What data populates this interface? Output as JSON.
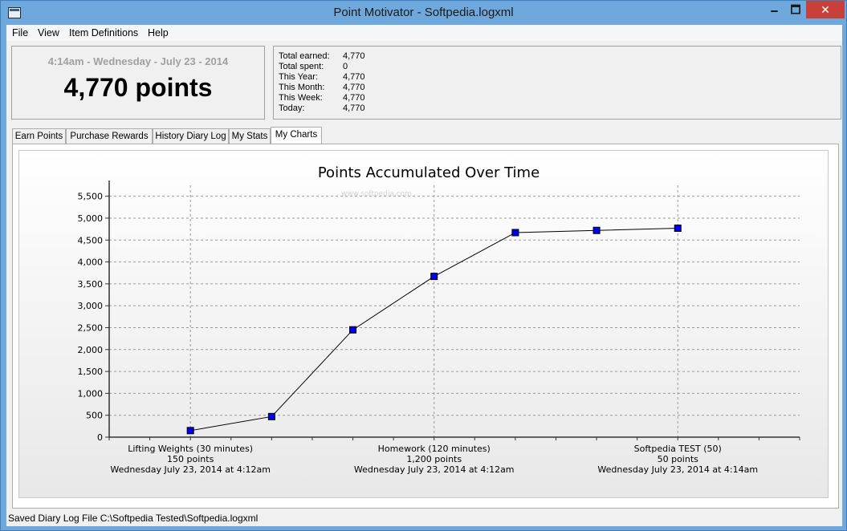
{
  "window": {
    "title": "Point Motivator - Softpedia.logxml",
    "min_label": "🗕",
    "max_label": "🗖",
    "close_label": "✕"
  },
  "menu": {
    "items": [
      "File",
      "View",
      "Item Definitions",
      "Help"
    ]
  },
  "summary": {
    "datetime": "4:14am - Wednesday - July 23 - 2014",
    "points": "4,770 points"
  },
  "stats": [
    {
      "label": "Total earned:",
      "value": "4,770"
    },
    {
      "label": "Total spent:",
      "value": "0"
    },
    {
      "label": "This Year:",
      "value": "4,770"
    },
    {
      "label": "This Month:",
      "value": "4,770"
    },
    {
      "label": "This Week:",
      "value": "4,770"
    },
    {
      "label": "Today:",
      "value": "4,770"
    }
  ],
  "tabs": [
    {
      "label": "Earn Points"
    },
    {
      "label": "Purchase Rewards"
    },
    {
      "label": "History Diary Log"
    },
    {
      "label": "My Stats"
    },
    {
      "label": "My Charts",
      "active": true
    }
  ],
  "chart_data": {
    "type": "line",
    "title": "Points Accumulated Over Time",
    "watermark": "www.softpedia.com",
    "ylim": [
      0,
      5750
    ],
    "yticks": [
      0,
      500,
      1000,
      1500,
      2000,
      2500,
      3000,
      3500,
      4000,
      4500,
      5000,
      5500
    ],
    "ytick_labels": [
      "0",
      "500",
      "1,000",
      "1,500",
      "2,000",
      "2,500",
      "3,000",
      "3,500",
      "4,000",
      "4,500",
      "5,000",
      "5,500"
    ],
    "grid": true,
    "marker_color": "#0000ee",
    "x_labels": [
      {
        "at": 1,
        "lines": [
          "Lifting Weights (30 minutes)",
          "150 points",
          "Wednesday July 23, 2014 at 4:12am"
        ]
      },
      {
        "at": 4,
        "lines": [
          "Homework (120 minutes)",
          "1,200 points",
          "Wednesday July 23, 2014 at 4:12am"
        ]
      },
      {
        "at": 7,
        "lines": [
          "Softpedia TEST (50)",
          "50 points",
          "Wednesday July 23, 2014 at 4:14am"
        ]
      }
    ],
    "xlim": [
      0,
      8.5
    ],
    "x": [
      1,
      2,
      3,
      4,
      5,
      6,
      7
    ],
    "values": [
      150,
      470,
      2450,
      3670,
      4670,
      4720,
      4770
    ]
  },
  "status": {
    "text": "Saved Diary Log File C:\\Softpedia Tested\\Softpedia.logxml"
  }
}
